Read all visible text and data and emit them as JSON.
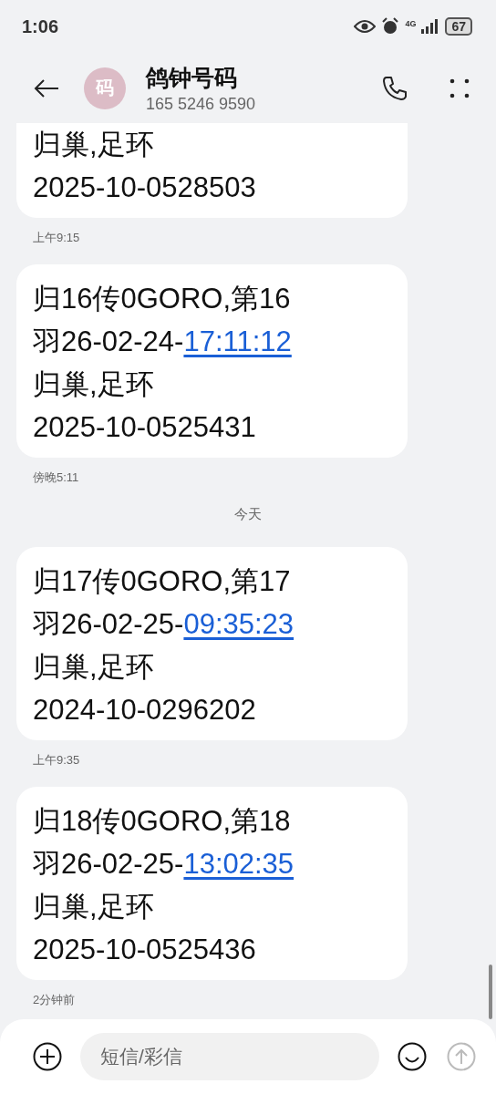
{
  "status_bar": {
    "time": "1:06",
    "network": "4G",
    "battery": "67"
  },
  "header": {
    "avatar_letter": "码",
    "title": "鸽钟号码",
    "phone_number": "165 5246 9590"
  },
  "conversation": [
    {
      "kind": "message",
      "cut_top": true,
      "lines": [
        {
          "text": "归巢,足环"
        },
        {
          "text": "2025-10-0528503"
        }
      ]
    },
    {
      "kind": "time",
      "text": "上午9:15"
    },
    {
      "kind": "message",
      "cut_top": false,
      "lines": [
        {
          "text": "归16传0GORO,第16"
        },
        {
          "text": "羽26-02-24-",
          "link": "17:11:12"
        },
        {
          "text": "归巢,足环"
        },
        {
          "text": "2025-10-0525431"
        }
      ]
    },
    {
      "kind": "time",
      "text": "傍晚5:11"
    },
    {
      "kind": "date",
      "text": "今天"
    },
    {
      "kind": "message",
      "cut_top": false,
      "lines": [
        {
          "text": "归17传0GORO,第17"
        },
        {
          "text": "羽26-02-25-",
          "link": "09:35:23"
        },
        {
          "text": "归巢,足环"
        },
        {
          "text": "2024-10-0296202"
        }
      ]
    },
    {
      "kind": "time",
      "text": "上午9:35"
    },
    {
      "kind": "message",
      "cut_top": false,
      "lines": [
        {
          "text": "归18传0GORO,第18"
        },
        {
          "text": "羽26-02-25-",
          "link": "13:02:35"
        },
        {
          "text": "归巢,足环"
        },
        {
          "text": "2025-10-0525436"
        }
      ]
    },
    {
      "kind": "time",
      "text": "2分钟前"
    }
  ],
  "composer": {
    "placeholder": "短信/彩信",
    "send_disabled": true
  }
}
